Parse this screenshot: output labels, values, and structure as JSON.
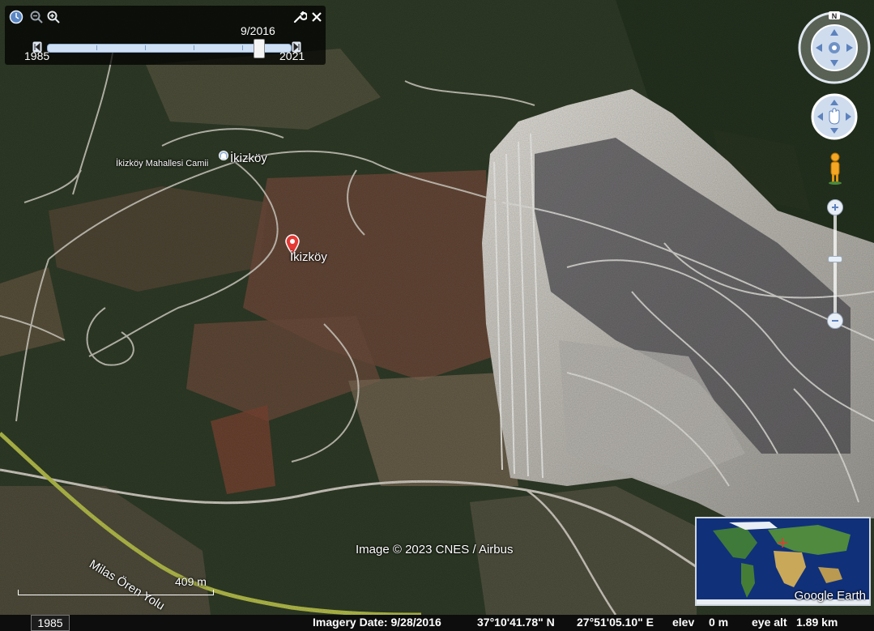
{
  "time_slider": {
    "current_date": "9/2016",
    "start_year": "1985",
    "end_year": "2021",
    "position_fraction": 0.87
  },
  "map": {
    "places": [
      {
        "label": "İkizköy"
      },
      {
        "label": "İkizköy Mahallesi Camii"
      }
    ],
    "pin_label": "İkizköy",
    "road_label": "Milas Ören Yolu",
    "scale_label": "409 m",
    "attribution": "Image © 2023 CNES / Airbus",
    "overview_logo": "Google Earth"
  },
  "status_bar": {
    "year_box": "1985",
    "imagery_date": "Imagery Date: 9/28/2016",
    "latitude": "37°10'41.78\" N",
    "longitude": "27°51'05.10\" E",
    "elev_label": "elev",
    "elev_value": "0 m",
    "eye_alt_label": "eye alt",
    "eye_alt_value": "1.89 km"
  },
  "colors": {
    "forest": "#2d3a25",
    "mine": "#c9c6bf",
    "highway": "#b8c24a",
    "panel": "#000000",
    "pin": "#e53935"
  },
  "icons": [
    "clock-icon",
    "zoom-out-icon",
    "zoom-in-icon",
    "wrench-icon",
    "close-icon",
    "compass-icon",
    "pan-hand-icon",
    "pegman-icon",
    "mosque-icon",
    "map-pin-icon"
  ]
}
